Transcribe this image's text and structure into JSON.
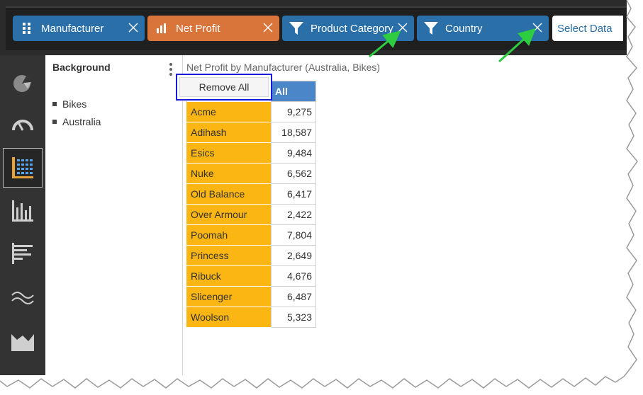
{
  "filter_bar": {
    "chips": [
      {
        "label": "Manufacturer",
        "icon": "grid-icon",
        "color": "#2a6fa8"
      },
      {
        "label": "Net Profit",
        "icon": "bar-chart-icon",
        "color": "#d9743a"
      },
      {
        "label": "Product Category",
        "icon": "funnel-icon",
        "color": "#2a6fa8"
      },
      {
        "label": "Country",
        "icon": "funnel-icon",
        "color": "#2a6fa8"
      }
    ],
    "select_data_label": "Select Data"
  },
  "left_nav": {
    "items": [
      {
        "icon": "pie-chart-icon"
      },
      {
        "icon": "gauge-icon"
      },
      {
        "icon": "table-grid-icon",
        "active": true
      },
      {
        "icon": "column-chart-icon"
      },
      {
        "icon": "bar-chart-horizontal-icon"
      },
      {
        "icon": "line-wave-icon"
      },
      {
        "icon": "area-chart-icon"
      }
    ]
  },
  "filter_panel": {
    "title": "Background",
    "items": [
      "Bikes",
      "Australia"
    ],
    "menu_option": "Remove All"
  },
  "main": {
    "title": "Net Profit by Manufacturer (Australia, Bikes)",
    "column_header": "All",
    "rows": [
      {
        "name": "Acme",
        "value": "9,275"
      },
      {
        "name": "Adihash",
        "value": "18,587"
      },
      {
        "name": "Esics",
        "value": "9,484"
      },
      {
        "name": "Nuke",
        "value": "6,562"
      },
      {
        "name": "Old Balance",
        "value": "6,417"
      },
      {
        "name": "Over Armour",
        "value": "2,422"
      },
      {
        "name": "Poomah",
        "value": "7,804"
      },
      {
        "name": "Princess",
        "value": "2,649"
      },
      {
        "name": "Ribuck",
        "value": "4,676"
      },
      {
        "name": "Slicenger",
        "value": "6,487"
      },
      {
        "name": "Woolson",
        "value": "5,323"
      }
    ]
  },
  "colors": {
    "accent_blue": "#2a6fa8",
    "accent_orange": "#d9743a",
    "cell_yellow": "#fcb614",
    "header_blue": "#4a86c8",
    "annotation_green": "#2ecc40",
    "highlight_box": "#1a1adb"
  }
}
